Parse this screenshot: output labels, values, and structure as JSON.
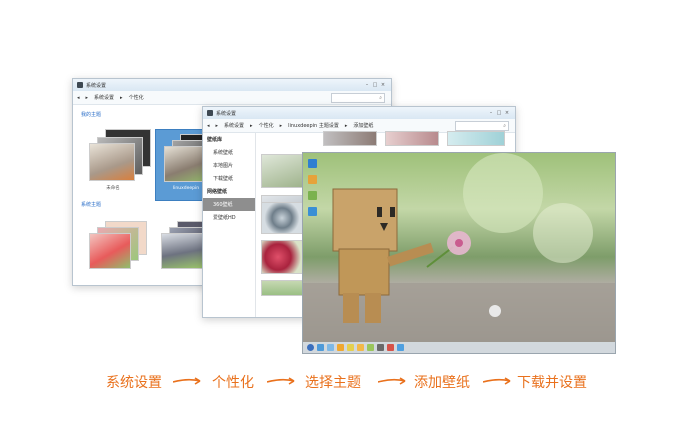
{
  "win1": {
    "title": "系统设置",
    "breadcrumb": [
      "系统设置",
      "个性化"
    ],
    "sections": [
      "我的主题",
      "系统主题"
    ],
    "theme_captions": [
      "未命名",
      "linuxdeepin"
    ]
  },
  "win2": {
    "title": "系统设置",
    "breadcrumb": [
      "系统设置",
      "个性化",
      "linuxdeepin 主题设置",
      "添加壁纸"
    ],
    "sidebar": {
      "group1": "壁纸库",
      "group1_items": [
        "系统壁纸",
        "本地图片",
        "下载壁纸"
      ],
      "group2": "网络壁纸",
      "group2_items": [
        "360壁纸",
        "爱壁纸HD"
      ],
      "active_item": "360壁纸"
    }
  },
  "steps": {
    "items": [
      "系统设置",
      "个性化",
      "选择主题",
      "添加壁纸",
      "下载并设置"
    ],
    "color": "#e9711d"
  }
}
